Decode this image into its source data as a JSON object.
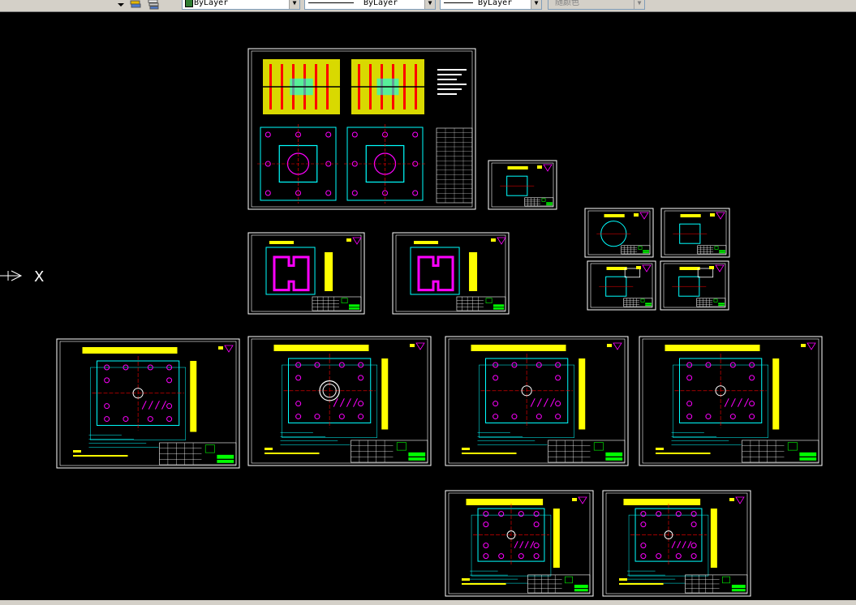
{
  "toolbar": {
    "color_combo": {
      "value": "ByLayer",
      "swatch_color": "#2e7d32"
    },
    "linetype_combo": {
      "value": "ByLayer"
    },
    "lineweight_combo": {
      "value": "ByLayer"
    },
    "plotstyle_combo": {
      "value": "随颜色"
    },
    "layer_icons": [
      "layers-icon",
      "layer-states-icon"
    ]
  },
  "canvas": {
    "background": "#000000",
    "ucs_label": "X",
    "colors": {
      "frame": "#ffffff",
      "cyan": "#00ffff",
      "yellow": "#ffff00",
      "magenta": "#ff00ff",
      "red": "#ff0000",
      "green": "#00ff00"
    }
  },
  "sheets": [
    {
      "id": "assembly"
    },
    {
      "id": "part-small"
    },
    {
      "id": "part-ring"
    },
    {
      "id": "part-slot"
    },
    {
      "id": "part-block-a"
    },
    {
      "id": "part-block-b"
    },
    {
      "id": "cavity-plate-1"
    },
    {
      "id": "cavity-plate-2"
    },
    {
      "id": "plate-a"
    },
    {
      "id": "plate-b"
    },
    {
      "id": "plate-c"
    },
    {
      "id": "plate-d"
    },
    {
      "id": "plate-e"
    },
    {
      "id": "plate-f"
    }
  ]
}
